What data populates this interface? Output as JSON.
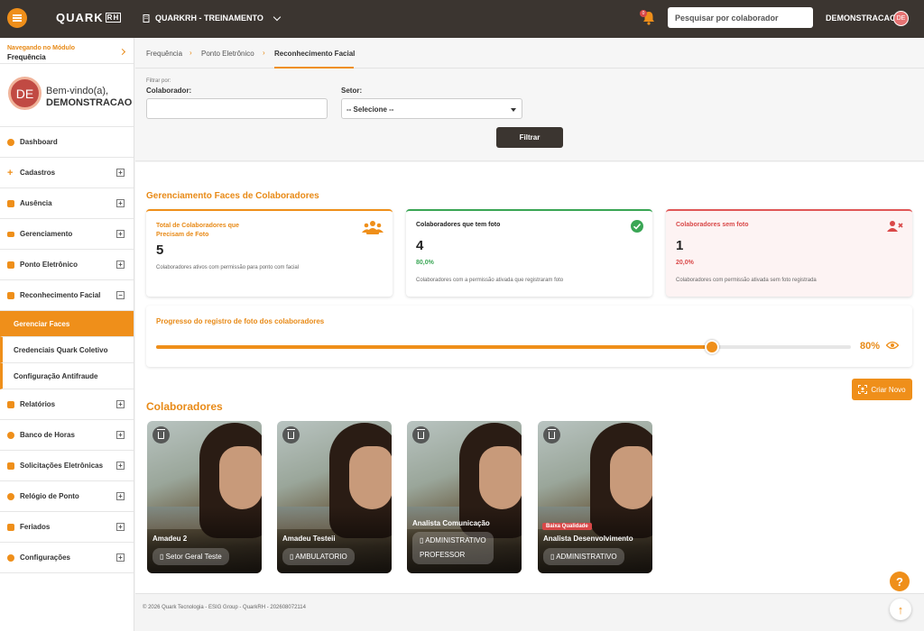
{
  "header": {
    "logo": "QUARK",
    "logo_suffix": "RH",
    "company": "QUARKRH - TREINAMENTO",
    "notification_count": "0",
    "search_placeholder": "Pesquisar por colaborador",
    "user": "DEMONSTRACAO",
    "user_initials": "DE"
  },
  "sidebar": {
    "module_label": "Navegando no Módulo",
    "module_name": "Frequência",
    "welcome": "Bem-vindo(a),",
    "user": "DEMONSTRACAO",
    "user_initials": "DE",
    "items": [
      {
        "label": "Dashboard"
      },
      {
        "label": "Cadastros"
      },
      {
        "label": "Ausência"
      },
      {
        "label": "Gerenciamento"
      },
      {
        "label": "Ponto Eletrônico"
      },
      {
        "label": "Reconhecimento Facial"
      }
    ],
    "subitems": [
      {
        "label": "Gerenciar Faces"
      },
      {
        "label": "Credenciais Quark Coletivo"
      },
      {
        "label": "Configuração Antifraude"
      }
    ],
    "items_after": [
      {
        "label": "Relatórios"
      },
      {
        "label": "Banco de Horas"
      },
      {
        "label": "Solicitações Eletrônicas"
      },
      {
        "label": "Relógio de Ponto"
      },
      {
        "label": "Feriados"
      },
      {
        "label": "Configurações"
      }
    ]
  },
  "breadcrumb": [
    "Frequência",
    "Ponto Eletrônico",
    "Reconhecimento Facial"
  ],
  "filter": {
    "filter_by": "Filtrar por:",
    "colaborador_label": "Colaborador:",
    "colaborador_value": "",
    "setor_label": "Setor:",
    "setor_value": "-- Selecione --",
    "button": "Filtrar"
  },
  "dashboard": {
    "title": "Gerenciamento Faces de Colaboradores",
    "cards": [
      {
        "title": "Total de Colaboradores que Precisam de Foto",
        "value": "5",
        "percent": "",
        "desc": "Colaboradores ativos com permissão para ponto com facial",
        "color": "#e88a17"
      },
      {
        "title": "Colaboradores que tem foto",
        "value": "4",
        "percent": "80,0%",
        "desc": "Colaboradores com a permissão ativada que registraram foto",
        "color": "#3aa655"
      },
      {
        "title": "Colaboradores sem foto",
        "value": "1",
        "percent": "20,0%",
        "desc": "Colaboradores com permissão ativada sem foto registrada",
        "color": "#e05656"
      }
    ],
    "progress_title": "Progresso do registro de foto dos colaboradores",
    "progress_value": 0.8,
    "progress_label": "80%"
  },
  "colaboradores": {
    "title": "Colaboradores",
    "create_button": "Criar Novo",
    "items": [
      {
        "name": "Amadeu 2",
        "sectors": [
          "Setor Geral Teste"
        ],
        "badge": ""
      },
      {
        "name": "Amadeu Testeii",
        "sectors": [
          "AMBULATORIO"
        ],
        "badge": ""
      },
      {
        "name": "Analista Comunicação",
        "sectors": [
          "ADMINISTRATIVO",
          "PROFESSOR"
        ],
        "badge": ""
      },
      {
        "name": "Analista Desenvolvimento",
        "sectors": [
          "ADMINISTRATIVO"
        ],
        "badge": "Baixa Qualidade"
      }
    ]
  },
  "footer": {
    "text": "© 2026 Quark Tecnologia - ESIG Group - QuarkRH - 202608072114"
  },
  "colors": {
    "accent": "#ef8f1a",
    "topbar": "#3b3530",
    "success": "#3aa655",
    "danger": "#e05656"
  }
}
